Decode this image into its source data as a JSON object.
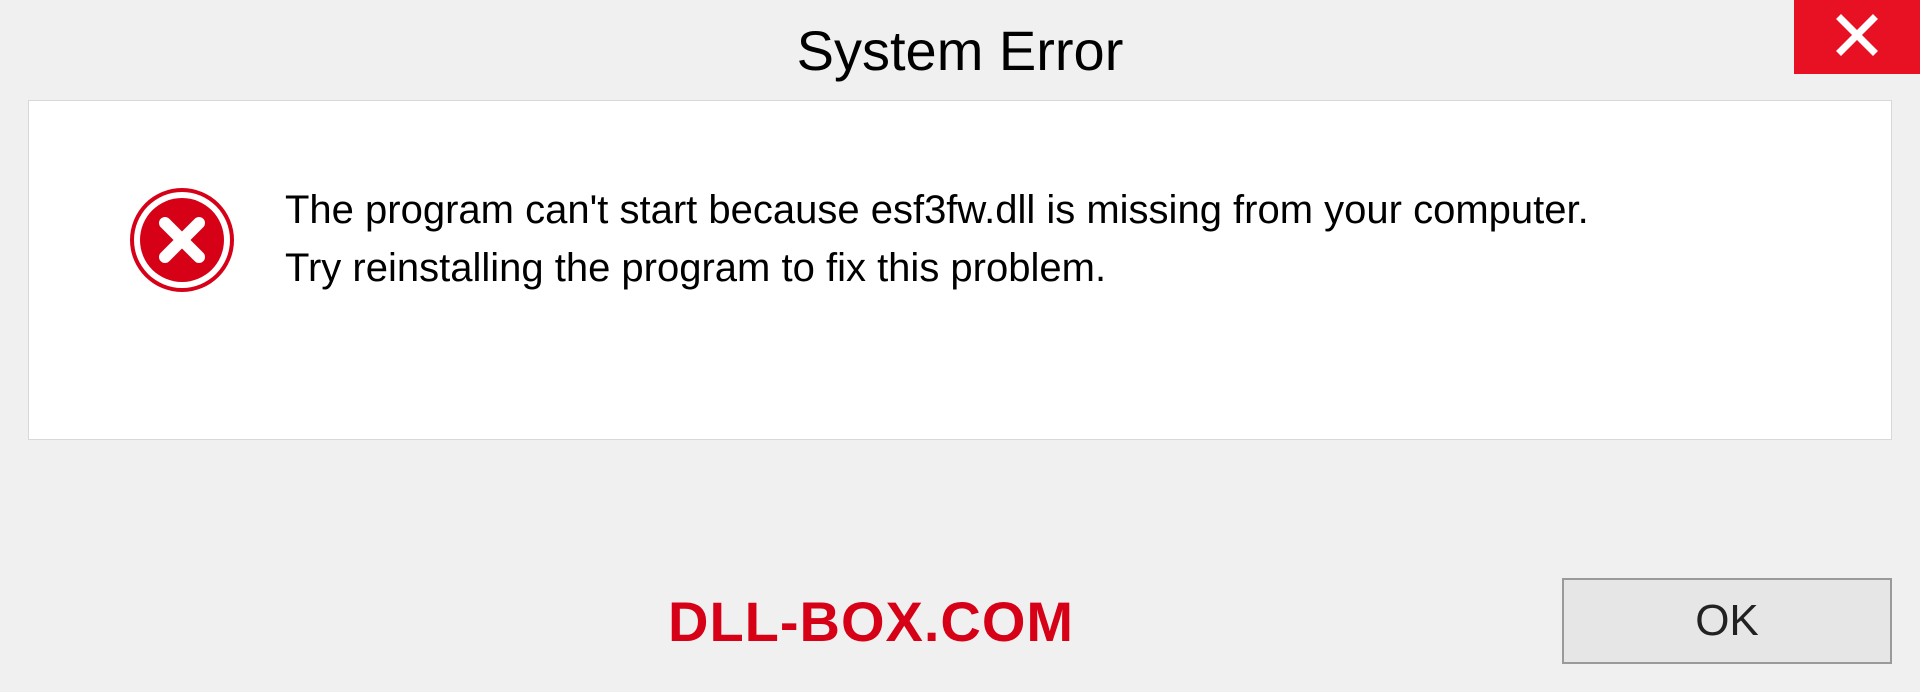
{
  "titlebar": {
    "title": "System Error"
  },
  "dialog": {
    "message_line1": "The program can't start because esf3fw.dll is missing from your computer.",
    "message_line2": "Try reinstalling the program to fix this problem."
  },
  "footer": {
    "brand": "DLL-BOX.COM",
    "ok_label": "OK"
  },
  "colors": {
    "close_bg": "#e81123",
    "error_icon": "#d60017",
    "brand": "#d60017"
  }
}
